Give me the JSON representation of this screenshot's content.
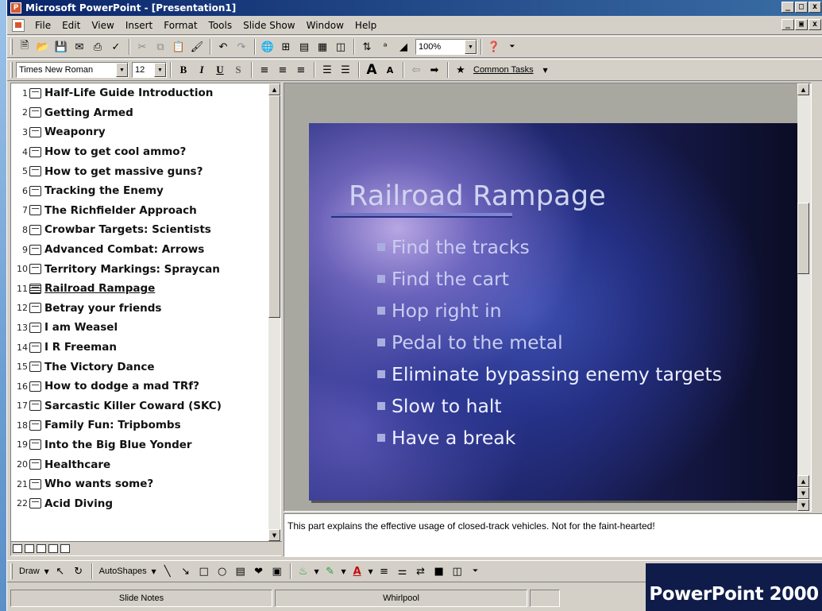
{
  "window": {
    "title": "Microsoft PowerPoint - [Presentation1]",
    "min_label": "_",
    "max_label": "Ɛ",
    "close_label": "x"
  },
  "menu": {
    "items": [
      "File",
      "Edit",
      "View",
      "Insert",
      "Format",
      "Tools",
      "Slide Show",
      "Window",
      "Help"
    ]
  },
  "standard_toolbar": {
    "zoom": "100%"
  },
  "formatting_toolbar": {
    "font_name": "Times New Roman",
    "font_size": "12",
    "bold": "B",
    "italic": "I",
    "underline": "U",
    "shadow": "S",
    "common_tasks": "Common Tasks"
  },
  "outline": {
    "current_slide": 11,
    "slides": [
      {
        "num": "1",
        "title": "Half-Life Guide Introduction"
      },
      {
        "num": "2",
        "title": "Getting Armed"
      },
      {
        "num": "3",
        "title": "Weaponry"
      },
      {
        "num": "4",
        "title": "How to get cool ammo?"
      },
      {
        "num": "5",
        "title": "How to get massive guns?"
      },
      {
        "num": "6",
        "title": "Tracking the Enemy"
      },
      {
        "num": "7",
        "title": "The Richfielder Approach"
      },
      {
        "num": "8",
        "title": "Crowbar Targets: Scientists"
      },
      {
        "num": "9",
        "title": "Advanced Combat: Arrows"
      },
      {
        "num": "10",
        "title": "Territory Markings: Spraycan"
      },
      {
        "num": "11",
        "title": "Railroad Rampage"
      },
      {
        "num": "12",
        "title": "Betray your friends"
      },
      {
        "num": "13",
        "title": "I am Weasel"
      },
      {
        "num": "14",
        "title": "I R Freeman"
      },
      {
        "num": "15",
        "title": "The  Victory Dance"
      },
      {
        "num": "16",
        "title": "How to dodge a mad TRf?"
      },
      {
        "num": "17",
        "title": "Sarcastic Killer Coward (SKC)"
      },
      {
        "num": "18",
        "title": "Family Fun: Tripbombs"
      },
      {
        "num": "19",
        "title": "Into the Big Blue Yonder"
      },
      {
        "num": "20",
        "title": "Healthcare"
      },
      {
        "num": "21",
        "title": "Who wants some?"
      },
      {
        "num": "22",
        "title": "Acid Diving"
      }
    ]
  },
  "slide": {
    "title": "Railroad Rampage",
    "bullets": [
      "Find the tracks",
      "Find the cart",
      "Hop right in",
      "Pedal to the metal",
      "Eliminate bypassing enemy targets",
      "Slow to halt",
      "Have a break"
    ]
  },
  "notes": {
    "text": "This part explains the effective usage of closed-track vehicles. Not for the faint-hearted!"
  },
  "drawing_toolbar": {
    "draw": "Draw",
    "autoshapes": "AutoShapes"
  },
  "status": {
    "slide_notes": "Slide Notes",
    "design": "Whirlpool"
  },
  "caption": {
    "text": "PowerPoint 2000"
  }
}
